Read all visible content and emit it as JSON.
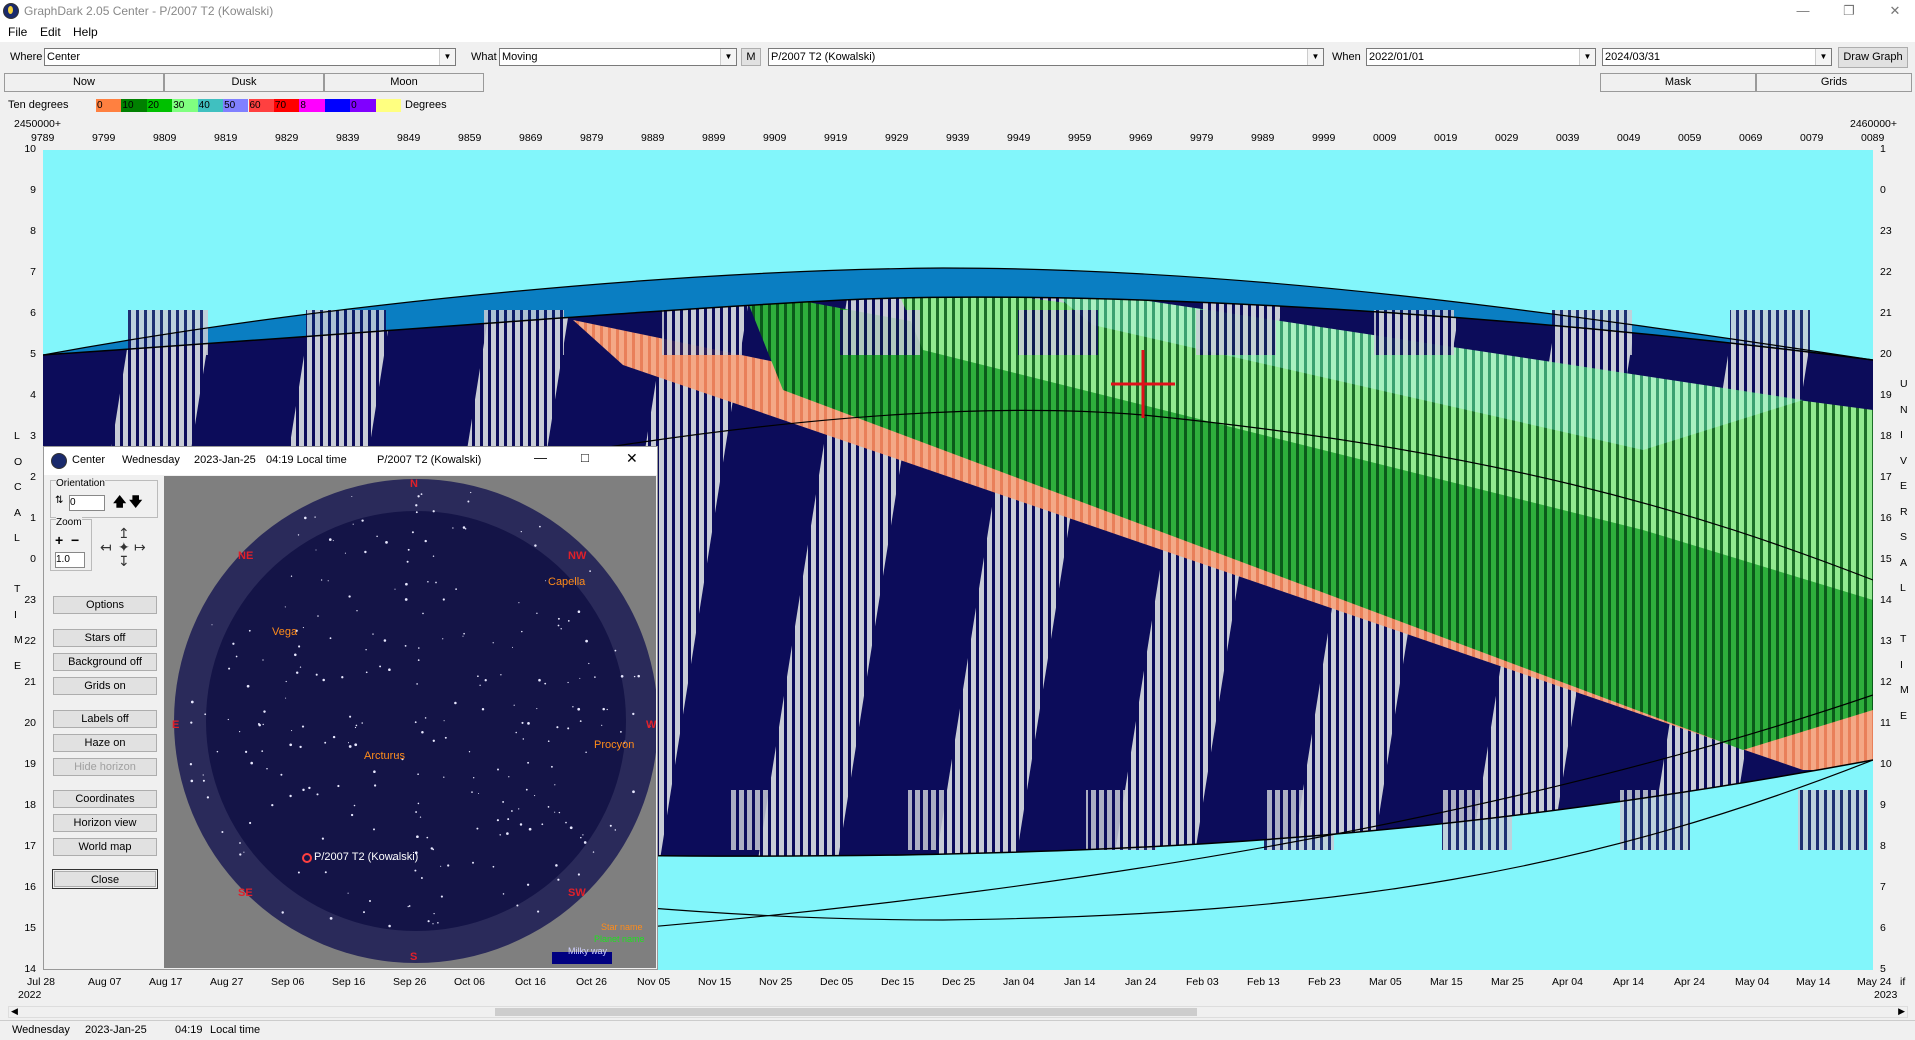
{
  "window": {
    "title": "GraphDark 2.05 Center  -  P/2007 T2 (Kowalski)"
  },
  "menu": [
    "File",
    "Edit",
    "Help"
  ],
  "toolbar": {
    "where_label": "Where",
    "where_value": "Center",
    "what_label": "What",
    "what_value": "Moving",
    "m_button": "M",
    "object_value": "P/2007 T2 (Kowalski)",
    "when_label": "When",
    "start_date": "2022/01/01",
    "end_date": "2024/03/31",
    "draw_button": "Draw Graph"
  },
  "tabs": {
    "now": "Now",
    "dusk": "Dusk",
    "moon": "Moon",
    "mask": "Mask",
    "grids": "Grids"
  },
  "legend": {
    "title": "Ten degrees",
    "swatches": [
      {
        "label": "0",
        "color": "#ff8040"
      },
      {
        "label": "10",
        "color": "#008000"
      },
      {
        "label": "20",
        "color": "#00c000"
      },
      {
        "label": "30",
        "color": "#80ff80"
      },
      {
        "label": "40",
        "color": "#40c0c0"
      },
      {
        "label": "50",
        "color": "#8080ff"
      },
      {
        "label": "60",
        "color": "#ff4040"
      },
      {
        "label": "70",
        "color": "#ff0000"
      },
      {
        "label": "8",
        "color": "#ff00ff"
      },
      {
        "label": "",
        "color": "#0000ff"
      },
      {
        "label": "0",
        "color": "#8000ff"
      },
      {
        "label": "",
        "color": "#ffff80"
      }
    ],
    "unit": "Degrees"
  },
  "top_axis": {
    "left_prefix": "2450000+",
    "right_prefix": "2460000+",
    "ticks": [
      "9789",
      "9799",
      "9809",
      "9819",
      "9829",
      "9839",
      "9849",
      "9859",
      "9869",
      "9879",
      "9889",
      "9899",
      "9909",
      "9919",
      "9929",
      "9939",
      "9949",
      "9959",
      "9969",
      "9979",
      "9989",
      "9999",
      "0009",
      "0019",
      "0029",
      "0039",
      "0049",
      "0059",
      "0069",
      "0079",
      "0089"
    ]
  },
  "left_axis": {
    "ticks": [
      "10",
      "9",
      "8",
      "7",
      "6",
      "5",
      "4",
      "3",
      "2",
      "1",
      "0",
      "23",
      "22",
      "21",
      "20",
      "19",
      "18",
      "17",
      "16",
      "15",
      "14"
    ],
    "title_letters": [
      "L",
      "O",
      "C",
      "A",
      "L",
      "",
      "T",
      "I",
      "M",
      "E"
    ]
  },
  "right_axis": {
    "ticks": [
      "1",
      "0",
      "23",
      "22",
      "21",
      "20",
      "19",
      "18",
      "17",
      "16",
      "15",
      "14",
      "13",
      "12",
      "11",
      "10",
      "9",
      "8",
      "7",
      "6",
      "5"
    ],
    "title_letters": [
      "U",
      "N",
      "I",
      "V",
      "E",
      "R",
      "S",
      "A",
      "L",
      "",
      "T",
      "I",
      "M",
      "E"
    ]
  },
  "bottom_axis": {
    "ticks": [
      "Jul 28",
      "Aug 07",
      "Aug 17",
      "Aug 27",
      "Sep 06",
      "Sep 16",
      "Sep 26",
      "Oct 06",
      "Oct 16",
      "Oct 26",
      "Nov 05",
      "Nov 15",
      "Nov 25",
      "Dec 05",
      "Dec 15",
      "Dec 25",
      "Jan 04",
      "Jan 14",
      "Jan 24",
      "Feb 03",
      "Feb 13",
      "Feb 23",
      "Mar 05",
      "Mar 15",
      "Mar 25",
      "Apr 04",
      "Apr 14",
      "Apr 24",
      "May 04",
      "May 14",
      "May 24"
    ],
    "year_left": "2022",
    "year_right": "2023",
    "right_mark": "if"
  },
  "colors": {
    "sky_day": "#82f6fb",
    "twilight": "#0a7ec2",
    "night": "#0c0c5a",
    "moonlit": "#c8ccd6",
    "object_low": "#f4a07a",
    "object_mid": "#00c000",
    "object_high": "#90ee90",
    "cursor": "#e0101a"
  },
  "mini_window": {
    "title": "Center",
    "weekday": "Wednesday",
    "date": "2023-Jan-25",
    "time": "04:19 Local time",
    "object": "P/2007 T2 (Kowalski)",
    "orientation_label": "Orientation",
    "orientation_value": "0",
    "zoom_label": "Zoom",
    "zoom_value": "1.0",
    "buttons": {
      "options": "Options",
      "stars": "Stars off",
      "background": "Background off",
      "grids": "Grids on",
      "labels": "Labels off",
      "haze": "Haze on",
      "hide_horizon": "Hide horizon",
      "coordinates": "Coordinates",
      "horizon_view": "Horizon view",
      "world_map": "World map",
      "close": "Close"
    },
    "directions": {
      "n": "N",
      "ne": "NE",
      "nw": "NW",
      "e": "E",
      "w": "W",
      "se": "SE",
      "sw": "SW",
      "s": "S"
    },
    "stars": {
      "capella": "Capella",
      "vega": "Vega",
      "arcturus": "Arcturus",
      "procyon": "Procyon"
    },
    "object_label": "P/2007 T2 (Kowalski)",
    "key": {
      "star": "Star name",
      "planet": "Planet name",
      "milky": "Milky way"
    }
  },
  "status": {
    "weekday": "Wednesday",
    "date": "2023-Jan-25",
    "time": "04:19",
    "label": "Local time"
  }
}
